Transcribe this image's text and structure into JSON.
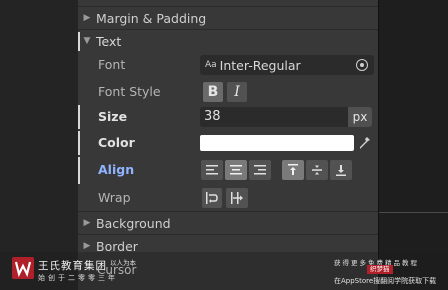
{
  "sections": {
    "margin_padding": "Margin & Padding",
    "text": "Text",
    "background": "Background",
    "border": "Border"
  },
  "text_section": {
    "font": {
      "label": "Font",
      "value": "Inter-Regular",
      "icon": "font-asset-icon"
    },
    "font_style": {
      "label": "Font Style",
      "bold": "B",
      "italic": "I"
    },
    "size": {
      "label": "Size",
      "value": "38",
      "unit": "px"
    },
    "color": {
      "label": "Color",
      "value": "#ffffff"
    },
    "align": {
      "label": "Align"
    },
    "wrap": {
      "label": "Wrap"
    }
  },
  "right_panel": {
    "paren": ")"
  },
  "watermark": {
    "brand": "王氏教育集团",
    "brand_sub": "始创于二零零三年",
    "tag": "以人为本",
    "overlay_text": "Cursor",
    "line1": "获得更多免费精品教程",
    "badge": "织梦猫",
    "line2": "在AppStore搜翻阅学院获取下载"
  },
  "colors": {
    "panel_bg": "#383838",
    "accent_label": "#8fb4ff",
    "brand_red": "#b0202a"
  }
}
